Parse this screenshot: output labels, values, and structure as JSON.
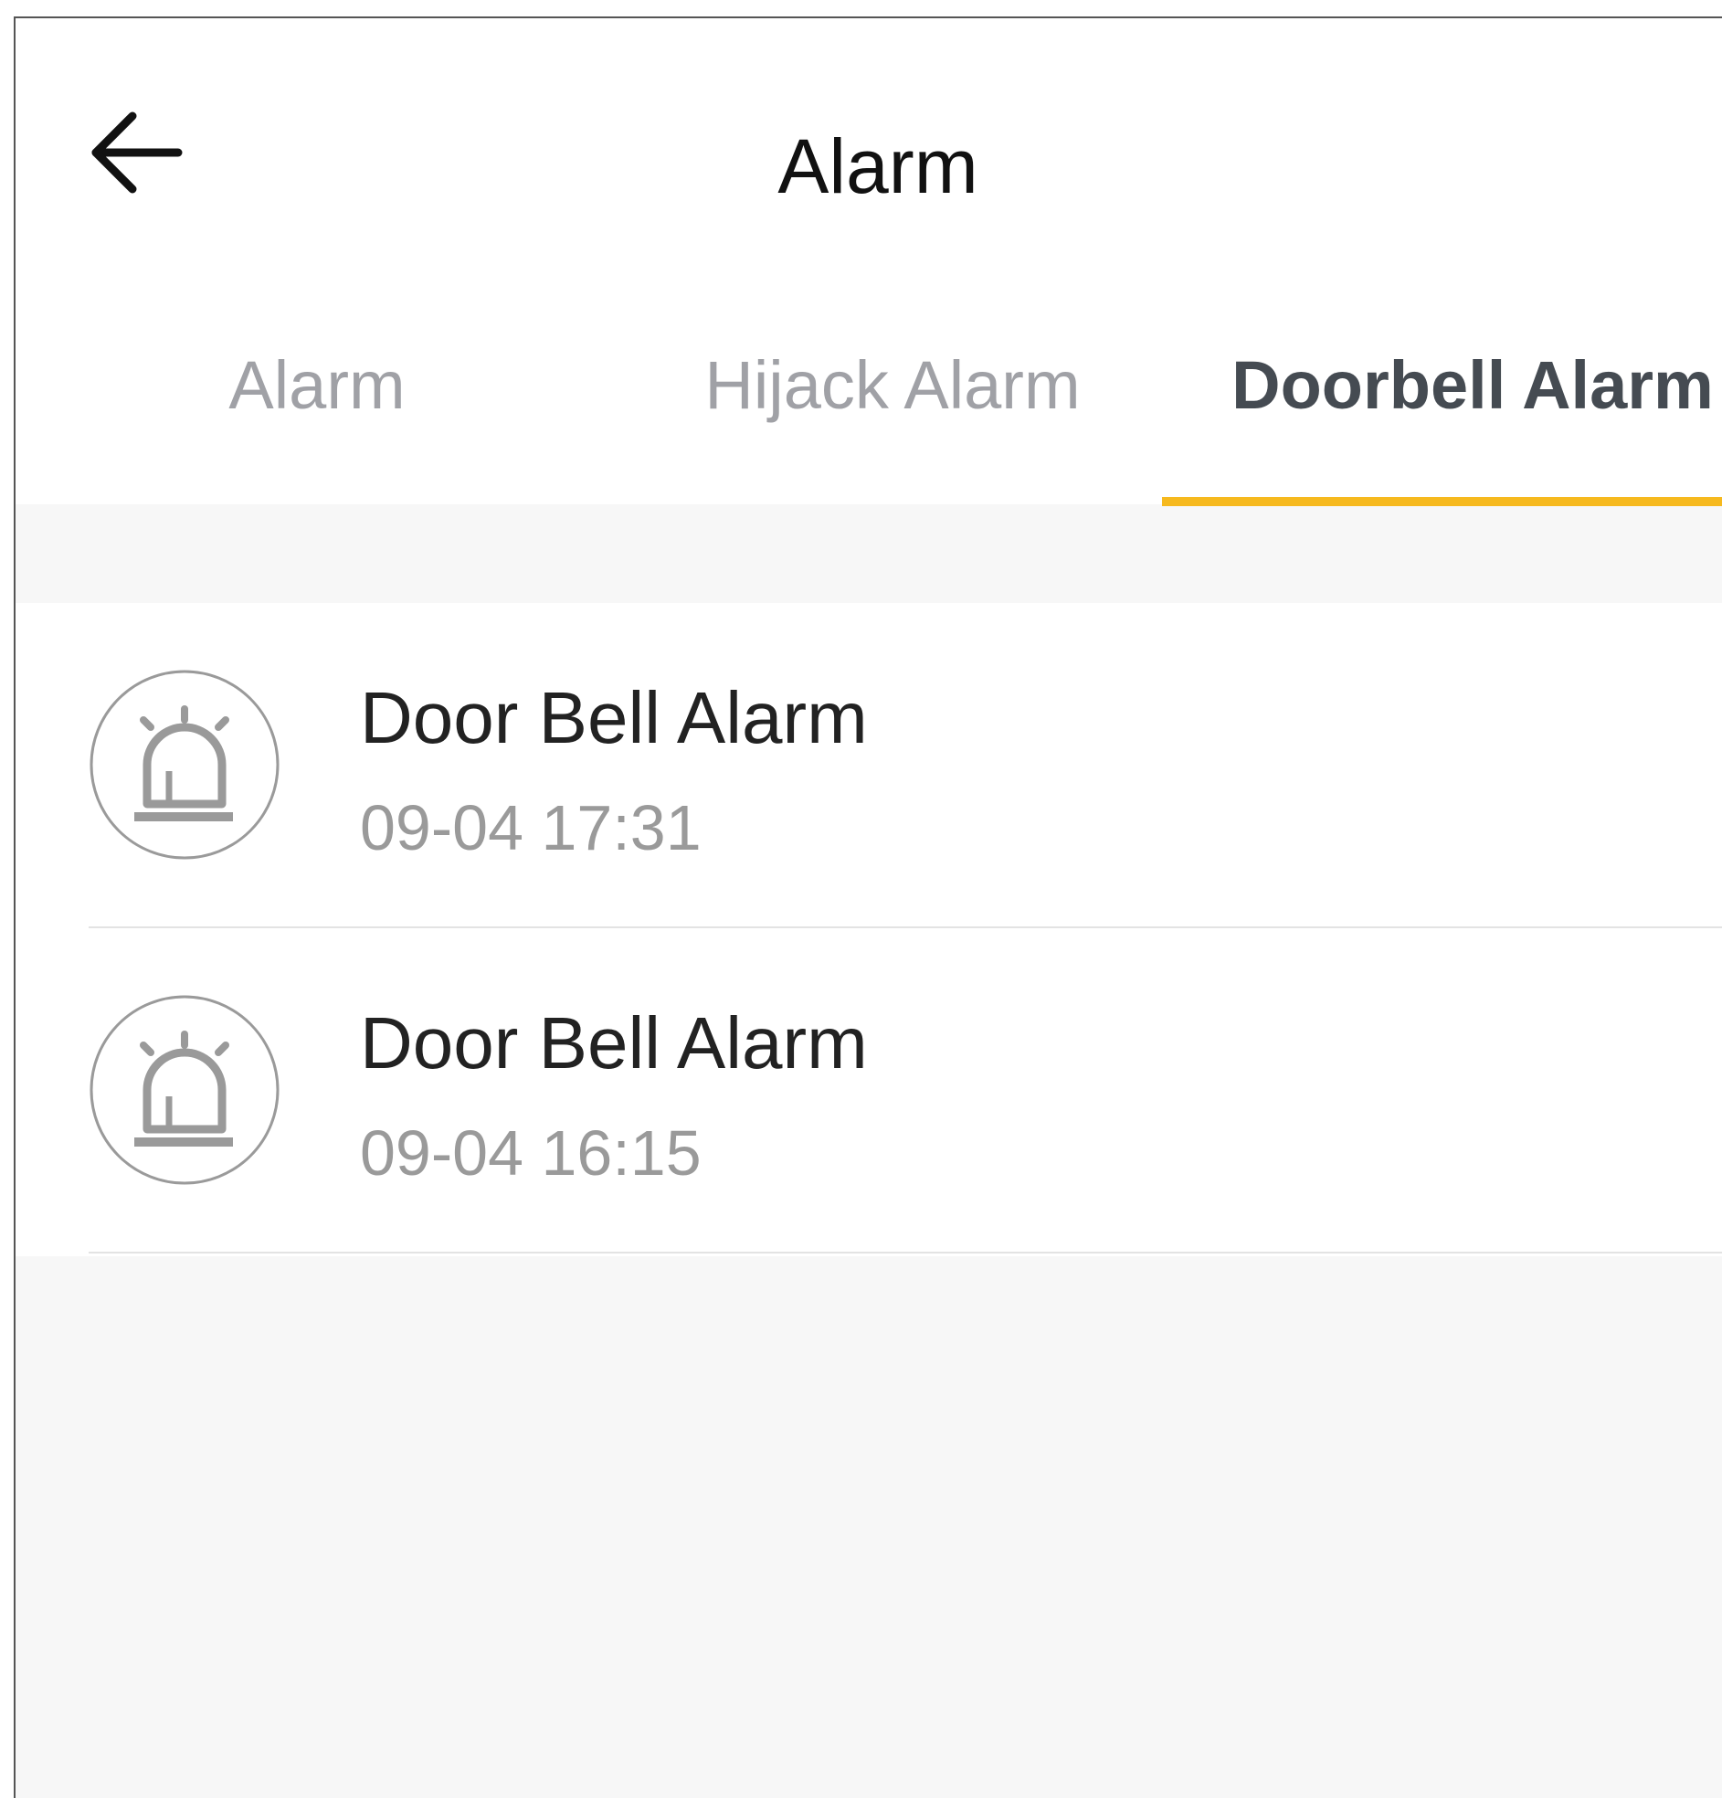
{
  "header": {
    "title": "Alarm",
    "back_icon": "arrow-left-icon"
  },
  "tabs": [
    {
      "label": "Alarm",
      "active": false
    },
    {
      "label": "Hijack Alarm",
      "active": false
    },
    {
      "label": "Doorbell Alarm",
      "active": true
    }
  ],
  "colors": {
    "accent": "#f6b91e",
    "active_tab_text": "#454b52",
    "inactive_tab_text": "#a0a1a6",
    "icon_gray": "#9a9a9a",
    "background": "#f7f7f7"
  },
  "alarms": [
    {
      "title": "Door Bell Alarm",
      "time": "09-04 17:31",
      "icon": "siren-icon"
    },
    {
      "title": "Door Bell Alarm",
      "time": "09-04 16:15",
      "icon": "siren-icon"
    }
  ]
}
